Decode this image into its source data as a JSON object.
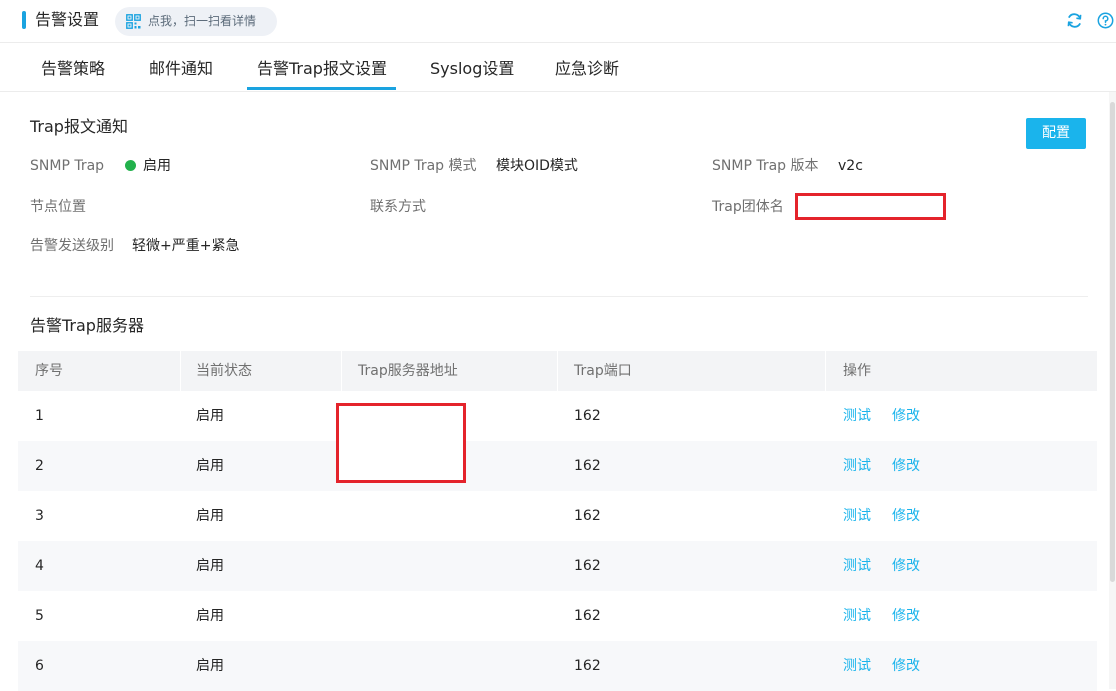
{
  "header": {
    "title": "告警设置",
    "scan_hint": "点我，扫一扫看详情",
    "icons": [
      "qr-code-icon",
      "refresh-icon",
      "help-icon"
    ],
    "accent_color": "#1aa3e0"
  },
  "tabs": [
    {
      "label": "告警策略",
      "active": false
    },
    {
      "label": "邮件通知",
      "active": false
    },
    {
      "label": "告警Trap报文设置",
      "active": true
    },
    {
      "label": "Syslog设置",
      "active": false
    },
    {
      "label": "应急诊断",
      "active": false
    }
  ],
  "trap_notice": {
    "title": "Trap报文通知",
    "config_button": "配置",
    "fields": {
      "snmp_trap": {
        "label": "SNMP Trap",
        "value": "启用",
        "status_color": "#22b14c"
      },
      "trap_mode": {
        "label": "SNMP Trap 模式",
        "value": "模块OID模式"
      },
      "trap_version": {
        "label": "SNMP Trap 版本",
        "value": "v2c"
      },
      "node_location": {
        "label": "节点位置",
        "value": ""
      },
      "contact": {
        "label": "联系方式",
        "value": ""
      },
      "community": {
        "label": "Trap团体名",
        "value": ""
      },
      "alarm_level": {
        "label": "告警发送级别",
        "value": "轻微+严重+紧急"
      }
    }
  },
  "servers": {
    "title": "告警Trap服务器",
    "columns": [
      "序号",
      "当前状态",
      "Trap服务器地址",
      "Trap端口",
      "操作"
    ],
    "rows": [
      {
        "index": "1",
        "status": "启用",
        "address": "",
        "port": "162",
        "test": "测试",
        "edit": "修改"
      },
      {
        "index": "2",
        "status": "启用",
        "address": "",
        "port": "162",
        "test": "测试",
        "edit": "修改"
      },
      {
        "index": "3",
        "status": "启用",
        "address": "",
        "port": "162",
        "test": "测试",
        "edit": "修改"
      },
      {
        "index": "4",
        "status": "启用",
        "address": "",
        "port": "162",
        "test": "测试",
        "edit": "修改"
      },
      {
        "index": "5",
        "status": "启用",
        "address": "",
        "port": "162",
        "test": "测试",
        "edit": "修改"
      },
      {
        "index": "6",
        "status": "启用",
        "address": "",
        "port": "162",
        "test": "测试",
        "edit": "修改"
      }
    ]
  }
}
